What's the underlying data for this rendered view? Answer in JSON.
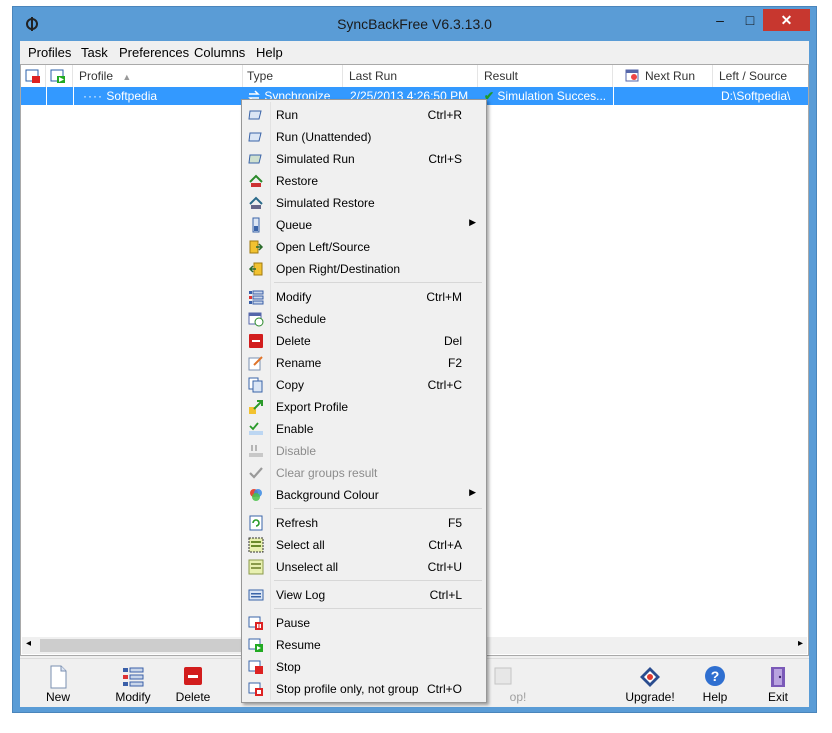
{
  "window": {
    "title": "SyncBackFree V6.3.13.0",
    "minimize": "–",
    "maximize": "□",
    "close": "✕"
  },
  "menu": [
    "Profiles",
    "Task",
    "Preferences",
    "Columns",
    "Help"
  ],
  "columns": {
    "profile": "Profile",
    "type": "Type",
    "last_run": "Last Run",
    "result": "Result",
    "next_run": "Next Run",
    "left_source": "Left / Source"
  },
  "row": {
    "profile": "Softpedia",
    "type": "Synchronize",
    "last_run": "2/25/2013 4:26:50 PM",
    "result": "Simulation Succes...",
    "left_source": "D:\\Softpedia\\"
  },
  "context_menu": [
    {
      "label": "Run",
      "shortcut": "Ctrl+R",
      "icon": "run-icon"
    },
    {
      "label": "Run (Unattended)",
      "shortcut": "",
      "icon": "run-unattended-icon"
    },
    {
      "label": "Simulated Run",
      "shortcut": "Ctrl+S",
      "icon": "simulated-run-icon"
    },
    {
      "label": "Restore",
      "shortcut": "",
      "icon": "restore-icon"
    },
    {
      "label": "Simulated Restore",
      "shortcut": "",
      "icon": "simulated-restore-icon"
    },
    {
      "label": "Queue",
      "shortcut": "",
      "icon": "queue-icon",
      "submenu": true
    },
    {
      "label": "Open Left/Source",
      "shortcut": "",
      "icon": "open-folder-icon"
    },
    {
      "label": "Open Right/Destination",
      "shortcut": "",
      "icon": "open-folder-icon"
    },
    {
      "label": "Modify",
      "shortcut": "Ctrl+M",
      "icon": "modify-icon"
    },
    {
      "label": "Schedule",
      "shortcut": "",
      "icon": "schedule-icon"
    },
    {
      "label": "Delete",
      "shortcut": "Del",
      "icon": "delete-icon"
    },
    {
      "label": "Rename",
      "shortcut": "F2",
      "icon": "rename-icon"
    },
    {
      "label": "Copy",
      "shortcut": "Ctrl+C",
      "icon": "copy-icon"
    },
    {
      "label": "Export Profile",
      "shortcut": "",
      "icon": "export-icon"
    },
    {
      "label": "Enable",
      "shortcut": "",
      "icon": "enable-icon"
    },
    {
      "label": "Disable",
      "shortcut": "",
      "icon": "disable-icon",
      "disabled": true
    },
    {
      "label": "Clear groups result",
      "shortcut": "",
      "icon": "clear-groups-icon",
      "disabled": true
    },
    {
      "label": "Background Colour",
      "shortcut": "",
      "icon": "palette-icon",
      "submenu": true
    },
    {
      "label": "Refresh",
      "shortcut": "F5",
      "icon": "refresh-icon"
    },
    {
      "label": "Select all",
      "shortcut": "Ctrl+A",
      "icon": "select-all-icon"
    },
    {
      "label": "Unselect all",
      "shortcut": "Ctrl+U",
      "icon": "unselect-all-icon"
    },
    {
      "label": "View Log",
      "shortcut": "Ctrl+L",
      "icon": "log-icon"
    },
    {
      "label": "Pause",
      "shortcut": "",
      "icon": "pause-icon"
    },
    {
      "label": "Resume",
      "shortcut": "",
      "icon": "resume-icon"
    },
    {
      "label": "Stop",
      "shortcut": "",
      "icon": "stop-icon"
    },
    {
      "label": "Stop profile only, not group",
      "shortcut": "Ctrl+O",
      "icon": "stop-profile-icon"
    }
  ],
  "toolbar": {
    "new": "New",
    "modify": "Modify",
    "delete": "Delete",
    "stop_partial": "op!",
    "upgrade": "Upgrade!",
    "help": "Help",
    "exit": "Exit"
  },
  "colors": {
    "selection": "#3399ff",
    "titlebar": "#5a9cd6",
    "close": "#c7372f",
    "menu_bg": "#f0f0f0"
  }
}
